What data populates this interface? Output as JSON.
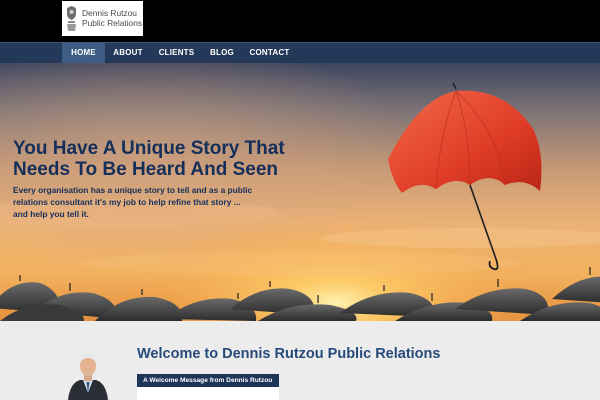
{
  "brand": {
    "name_line1": "Dennis Rutzou",
    "name_line2": "Public Relations"
  },
  "nav": {
    "items": [
      {
        "label": "HOME",
        "active": true
      },
      {
        "label": "ABOUT",
        "active": false
      },
      {
        "label": "CLIENTS",
        "active": false
      },
      {
        "label": "BLOG",
        "active": false
      },
      {
        "label": "CONTACT",
        "active": false
      }
    ]
  },
  "hero": {
    "title_line1": "You Have A Unique Story That",
    "title_line2": "Needs To Be Heard And Seen",
    "subtitle_line1": "Every organisation has a unique story to tell and as a public",
    "subtitle_line2": "relations consultant it's my job to help refine that story ...",
    "subtitle_line3": "and help you tell it."
  },
  "welcome": {
    "heading": "Welcome to Dennis Rutzou Public Relations",
    "tag": "A Welcome Message from Dennis Rutzou"
  },
  "colors": {
    "nav_background": "#24395a",
    "nav_active": "#3e5d85",
    "heading_blue": "#142f5a",
    "welcome_blue": "#264a7a",
    "umbrella_red": "#e0402a"
  },
  "icons": {
    "logo": "shield-crest-icon"
  }
}
